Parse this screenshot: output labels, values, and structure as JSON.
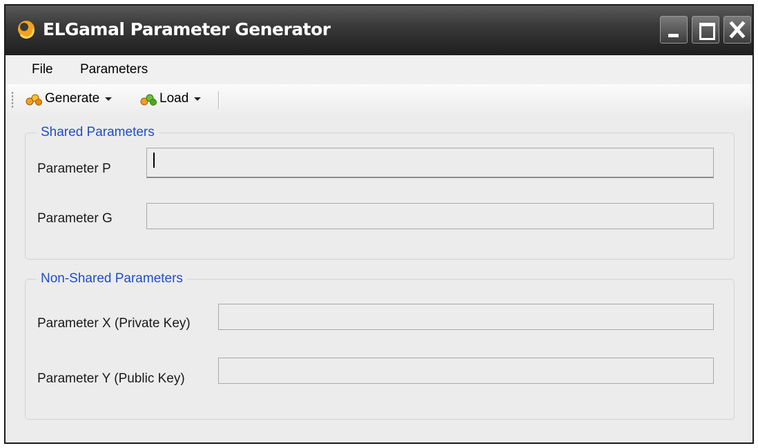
{
  "window": {
    "title": "ELGamal Parameter Generator",
    "controls": [
      "minimize-icon",
      "maximize-icon",
      "close-icon"
    ]
  },
  "menu": {
    "items": [
      "File",
      "Parameters"
    ]
  },
  "toolbar": {
    "generate_label": "Generate",
    "load_label": "Load",
    "icons": [
      "coins-orange-icon",
      "coins-green-icon"
    ]
  },
  "shared": {
    "title": "Shared Parameters",
    "p_label": "Parameter P",
    "p_value": "",
    "g_label": "Parameter G",
    "g_value": ""
  },
  "non_shared": {
    "title": "Non-Shared Parameters",
    "x_label": "Parameter X (Private Key)",
    "x_value": "",
    "y_label": "Parameter Y (Public Key)",
    "y_value": ""
  },
  "colors": {
    "group_title": "#1f4ec4",
    "titlebar": "#2a2a2a",
    "window_bg": "#ececec"
  }
}
